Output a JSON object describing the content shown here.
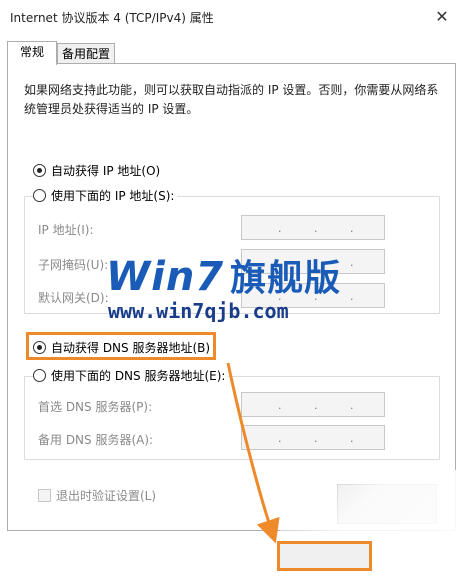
{
  "window": {
    "title": "Internet 协议版本 4 (TCP/IPv4) 属性",
    "close_glyph": "✕"
  },
  "tabs": [
    {
      "label": "常规",
      "active": true
    },
    {
      "label": "备用配置",
      "active": false
    }
  ],
  "general": {
    "description": "如果网络支持此功能，则可以获取自动指派的 IP 设置。否则，你需要从网络系统管理员处获得适当的 IP 设置。",
    "ip_auto_label": "自动获得 IP 地址(O)",
    "ip_auto_checked": true,
    "ip_manual_label": "使用下面的 IP 地址(S):",
    "ip_manual_checked": false,
    "ip_fields": [
      {
        "label": "IP 地址(I):"
      },
      {
        "label": "子网掩码(U):"
      },
      {
        "label": "默认网关(D):"
      }
    ],
    "dns_auto_label": "自动获得 DNS 服务器地址(B)",
    "dns_auto_checked": true,
    "dns_manual_label": "使用下面的 DNS 服务器地址(E):",
    "dns_manual_checked": false,
    "dns_fields": [
      {
        "label": "首选 DNS 服务器(P):"
      },
      {
        "label": "备用 DNS 服务器(A):"
      }
    ],
    "validate_label": "退出时验证设置(L)",
    "validate_checked": false
  },
  "watermark": {
    "logo_text": "Win7",
    "logo_cn": "旗舰版",
    "url": "www.win7qjb.com"
  },
  "colors": {
    "highlight": "#ee8a2a",
    "watermark_blue": "#1a5bb8"
  },
  "ip_dot": "."
}
